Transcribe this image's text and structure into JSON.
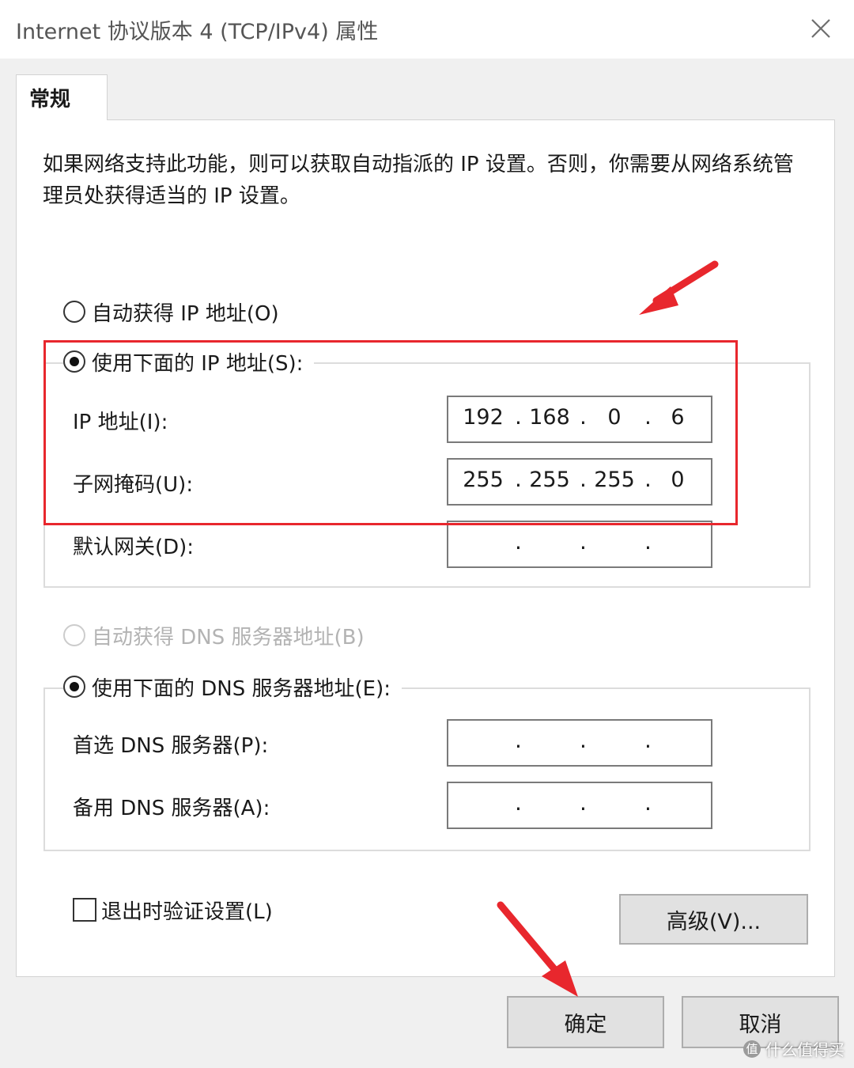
{
  "window": {
    "title": "Internet 协议版本 4 (TCP/IPv4) 属性"
  },
  "tabs": [
    {
      "label": "常规"
    }
  ],
  "description": "如果网络支持此功能，则可以获取自动指派的 IP 设置。否则，你需要从网络系统管理员处获得适当的 IP 设置。",
  "ip_section": {
    "auto_radio": {
      "label": "自动获得 IP 地址(O)",
      "checked": false
    },
    "manual_radio": {
      "label": "使用下面的 IP 地址(S):",
      "checked": true
    },
    "ip_address": {
      "label": "IP 地址(I):",
      "octets": [
        "192",
        "168",
        "0",
        "6"
      ]
    },
    "subnet_mask": {
      "label": "子网掩码(U):",
      "octets": [
        "255",
        "255",
        "255",
        "0"
      ]
    },
    "default_gateway": {
      "label": "默认网关(D):",
      "octets": [
        "",
        "",
        "",
        ""
      ]
    }
  },
  "dns_section": {
    "auto_radio": {
      "label": "自动获得 DNS 服务器地址(B)",
      "checked": false,
      "disabled": true
    },
    "manual_radio": {
      "label": "使用下面的 DNS 服务器地址(E):",
      "checked": true
    },
    "preferred": {
      "label": "首选 DNS 服务器(P):",
      "octets": [
        "",
        "",
        "",
        ""
      ]
    },
    "alternate": {
      "label": "备用 DNS 服务器(A):",
      "octets": [
        "",
        "",
        "",
        ""
      ]
    }
  },
  "validate_checkbox": {
    "label": "退出时验证设置(L)",
    "checked": false
  },
  "buttons": {
    "advanced": "高级(V)...",
    "ok": "确定",
    "cancel": "取消"
  },
  "annotation": {
    "highlight_color": "#e8272d"
  },
  "watermark": {
    "text": "什么值得买",
    "icon_glyph": "值"
  }
}
